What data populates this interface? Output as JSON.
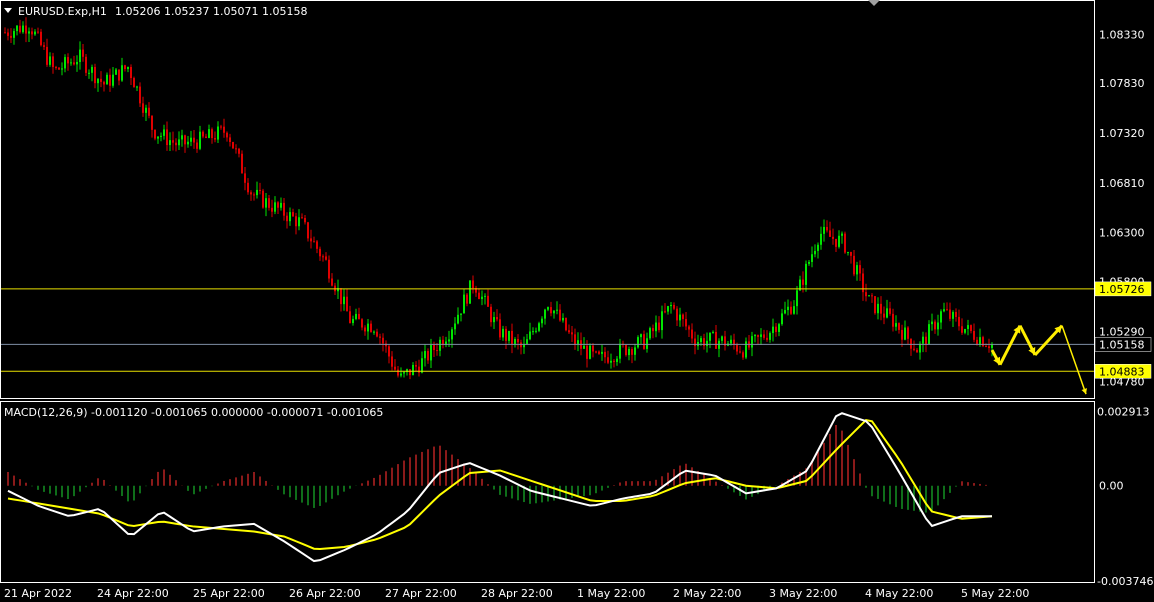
{
  "header": {
    "symbol": "EURUSD.Exp,H1",
    "ohlc": "1.05206 1.05237 1.05071 1.05158"
  },
  "macd_header": "MACD(12,26,9) -0.001120 -0.001065 0.000000 -0.000071 -0.001065",
  "price_axis": {
    "ticks": [
      "1.08330",
      "1.07830",
      "1.07320",
      "1.06810",
      "1.06300",
      "1.05800",
      "1.05290",
      "1.04780"
    ],
    "tick_values": [
      1.0833,
      1.0783,
      1.0732,
      1.0681,
      1.063,
      1.058,
      1.0529,
      1.0478
    ]
  },
  "macd_axis": {
    "ticks": [
      "0.002913",
      "0.00",
      "-0.003746"
    ],
    "tick_values": [
      0.002913,
      0.0,
      -0.003746
    ]
  },
  "time_axis": {
    "labels": [
      "21 Apr 2022",
      "24 Apr 22:00",
      "25 Apr 22:00",
      "26 Apr 22:00",
      "27 Apr 22:00",
      "28 Apr 22:00",
      "1 May 22:00",
      "2 May 22:00",
      "3 May 22:00",
      "4 May 22:00",
      "5 May 22:00"
    ]
  },
  "levels": [
    {
      "label": "1.05726",
      "value": 1.05726,
      "color": "#e8e000",
      "tag_bg": "#ffff00",
      "tag_fg": "#000000"
    },
    {
      "label": "1.04883",
      "value": 1.04883,
      "color": "#e8e000",
      "tag_bg": "#ffff00",
      "tag_fg": "#000000"
    }
  ],
  "bid": {
    "label": "1.05158",
    "value": 1.05158,
    "color": "#7f8fa6",
    "tag_bg": "#000000",
    "tag_fg": "#ffffff"
  },
  "colors": {
    "bull": "#00e600",
    "bear": "#e00000",
    "hist_pos": "#8b1a1a",
    "hist_neg": "#0f6e1a",
    "macd_line": "#ffffff",
    "signal_line": "#ffff00",
    "arrows": "#ffee00"
  },
  "chart_data": {
    "type": "candlestick",
    "symbol": "EURUSD",
    "timeframe": "H1",
    "close_anchor_values": [
      1.0835,
      1.0843,
      1.0795,
      1.081,
      1.0782,
      1.08,
      1.0735,
      1.072,
      1.0725,
      1.0735,
      1.067,
      1.0655,
      1.064,
      1.06,
      1.054,
      1.0535,
      1.048,
      1.05,
      1.053,
      1.058,
      1.053,
      1.051,
      1.056,
      1.052,
      1.05,
      1.051,
      1.052,
      1.0555,
      1.052,
      1.052,
      1.051,
      1.053,
      1.056,
      1.063,
      1.062,
      1.056,
      1.054,
      1.051,
      1.055,
      1.053,
      1.0516
    ],
    "projection_path": [
      1.051,
      1.0495,
      1.0535,
      1.0505,
      1.0535,
      1.0465
    ],
    "macd_anchor_values": [
      -0.0002,
      -0.0008,
      -0.0012,
      -0.0009,
      -0.002,
      -0.001,
      -0.0018,
      -0.0016,
      -0.0015,
      -0.0022,
      -0.003,
      -0.0025,
      -0.0019,
      -0.001,
      0.0005,
      0.0009,
      0.0004,
      -0.0002,
      -0.0005,
      -0.0008,
      -0.0005,
      -0.0003,
      0.0006,
      0.0004,
      -0.0003,
      -0.0001,
      0.0006,
      0.0029,
      0.0025,
      0.0005,
      -0.0016,
      -0.0012,
      -0.0012
    ],
    "signal_anchor_values": [
      -0.0005,
      -0.0007,
      -0.0009,
      -0.0011,
      -0.0016,
      -0.0014,
      -0.0016,
      -0.0017,
      -0.0018,
      -0.002,
      -0.0025,
      -0.0024,
      -0.0021,
      -0.0016,
      -0.0004,
      0.0005,
      0.0006,
      0.0002,
      -0.0002,
      -0.0006,
      -0.0006,
      -0.0004,
      0.0001,
      0.0003,
      0.0,
      -0.0001,
      0.0002,
      0.0015,
      0.0027,
      0.001,
      -0.001,
      -0.0013,
      -0.0012
    ],
    "price_range": [
      1.0462,
      1.0866
    ],
    "macd_range": [
      -0.003746,
      0.003254
    ]
  }
}
